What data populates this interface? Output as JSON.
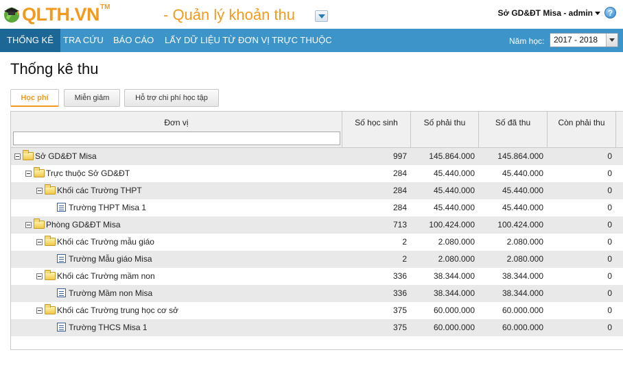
{
  "header": {
    "logo_text": "QLTH.VN",
    "logo_tm": "TM",
    "app_title": "- Quản lý khoản thu",
    "user_label": "Sở GD&ĐT Misa - admin",
    "help_glyph": "?"
  },
  "nav": {
    "items": [
      "THỐNG KÊ",
      "TRA CỨU",
      "BÁO CÁO",
      "LẤY DỮ LIỆU TỪ ĐƠN VỊ TRỰC THUỘC"
    ],
    "active_index": 0,
    "year_label": "Năm học:",
    "year_value": "2017 - 2018"
  },
  "page_title": "Thống kê thu",
  "tabs": [
    "Học phí",
    "Miễn giảm",
    "Hỗ trợ chi phí học tập"
  ],
  "active_tab": 0,
  "grid": {
    "columns": [
      "Đơn vị",
      "Số học sinh",
      "Số phải thu",
      "Số đã thu",
      "Còn phải thu"
    ],
    "filter_placeholder": "",
    "rows": [
      {
        "name": "Sở GD&ĐT Misa",
        "students": "997",
        "due": "145.864.000",
        "paid": "145.864.000",
        "remaining": "0"
      },
      {
        "name": "Trực thuộc Sở GD&ĐT",
        "students": "284",
        "due": "45.440.000",
        "paid": "45.440.000",
        "remaining": "0"
      },
      {
        "name": "Khối các Trường THPT",
        "students": "284",
        "due": "45.440.000",
        "paid": "45.440.000",
        "remaining": "0"
      },
      {
        "name": "Trường THPT Misa 1",
        "students": "284",
        "due": "45.440.000",
        "paid": "45.440.000",
        "remaining": "0"
      },
      {
        "name": "Phòng GD&ĐT Misa",
        "students": "713",
        "due": "100.424.000",
        "paid": "100.424.000",
        "remaining": "0"
      },
      {
        "name": "Khối các Trường mẫu giáo",
        "students": "2",
        "due": "2.080.000",
        "paid": "2.080.000",
        "remaining": "0"
      },
      {
        "name": "Trường Mẫu giáo Misa",
        "students": "2",
        "due": "2.080.000",
        "paid": "2.080.000",
        "remaining": "0"
      },
      {
        "name": "Khối các Trường mầm non",
        "students": "336",
        "due": "38.344.000",
        "paid": "38.344.000",
        "remaining": "0"
      },
      {
        "name": "Trường Mầm non Misa",
        "students": "336",
        "due": "38.344.000",
        "paid": "38.344.000",
        "remaining": "0"
      },
      {
        "name": "Khối các Trường trung học cơ sở",
        "students": "375",
        "due": "60.000.000",
        "paid": "60.000.000",
        "remaining": "0"
      },
      {
        "name": "Trường THCS Misa 1",
        "students": "375",
        "due": "60.000.000",
        "paid": "60.000.000",
        "remaining": "0"
      }
    ]
  },
  "colors": {
    "brand_orange": "#f39a1e",
    "nav_blue": "#3c94c9",
    "nav_active": "#1d6796"
  }
}
